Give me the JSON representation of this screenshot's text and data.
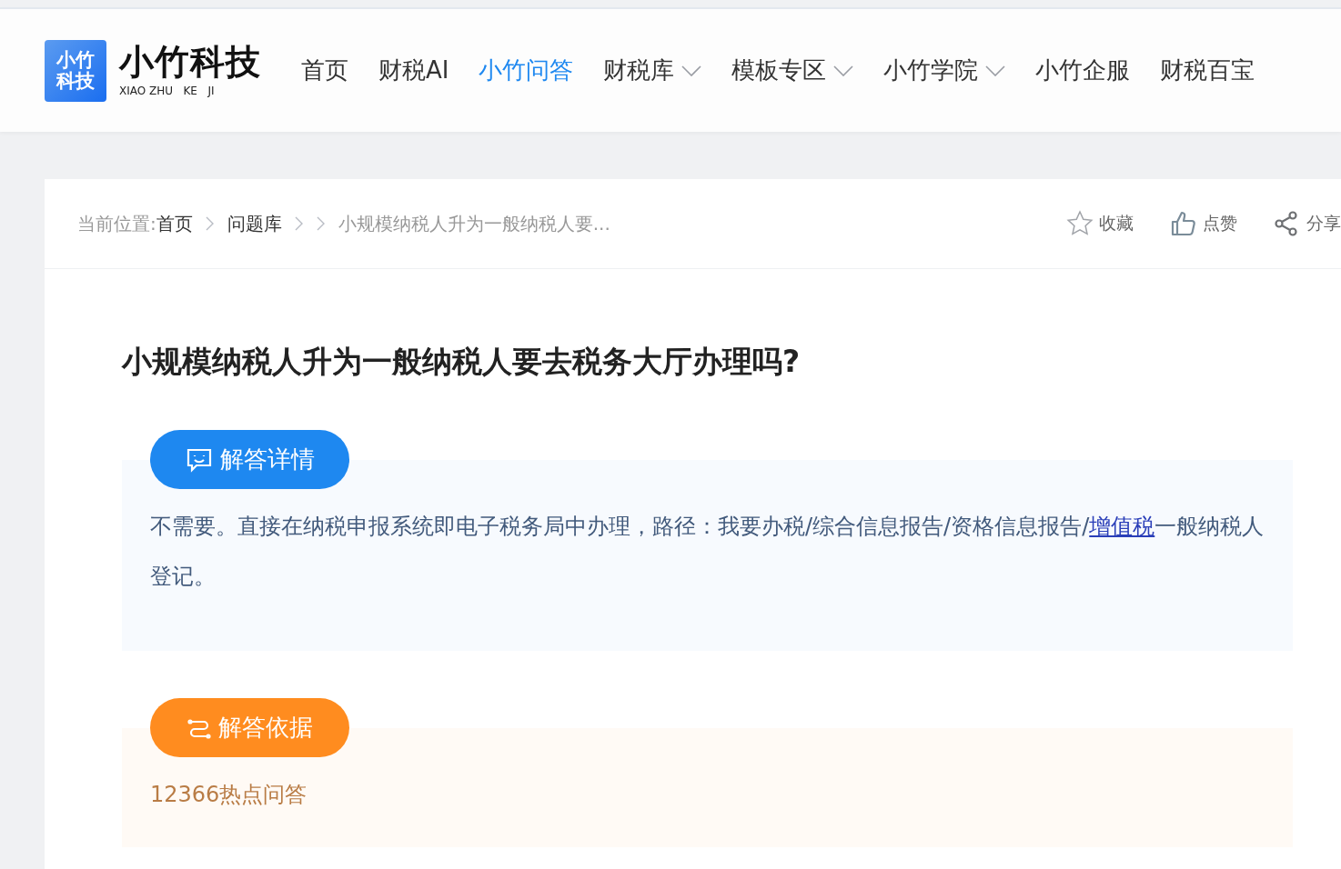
{
  "logo": {
    "mark": "小竹科技",
    "name": "小竹科技",
    "pinyin": "XIAO ZHU   KE   JI"
  },
  "nav": [
    {
      "label": "首页",
      "selected": false,
      "dropdown": false
    },
    {
      "label": "财税AI",
      "selected": false,
      "dropdown": false
    },
    {
      "label": "小竹问答",
      "selected": true,
      "dropdown": false
    },
    {
      "label": "财税库",
      "selected": false,
      "dropdown": true
    },
    {
      "label": "模板专区",
      "selected": false,
      "dropdown": true
    },
    {
      "label": "小竹学院",
      "selected": false,
      "dropdown": true
    },
    {
      "label": "小竹企服",
      "selected": false,
      "dropdown": false
    },
    {
      "label": "财税百宝",
      "selected": false,
      "dropdown": false
    }
  ],
  "breadcrumb": {
    "prefix": "当前位置:",
    "items": [
      {
        "label": "首页",
        "kind": "link"
      },
      {
        "label": "问题库",
        "kind": "link"
      },
      {
        "kind": "empty"
      },
      {
        "label": "小规模纳税人升为一般纳税人要...",
        "kind": "current"
      }
    ]
  },
  "actions": [
    {
      "label": "收藏",
      "kind": "star"
    },
    {
      "label": "点赞",
      "kind": "thumb"
    },
    {
      "label": "分享",
      "kind": "share"
    }
  ],
  "question": {
    "title": "小规模纳税人升为一般纳税人要去税务大厅办理吗?"
  },
  "sections": [
    {
      "kind": "answer",
      "button": "解答详情",
      "parts": [
        {
          "text": "不需要。直接在纳税申报系统即电子税务局中办理，路径：我要办税/综合信息报告/资格信息报告/",
          "link": false
        },
        {
          "text": "增值税",
          "link": true
        },
        {
          "text": "一般纳税人登记。",
          "link": false
        }
      ]
    },
    {
      "kind": "basis",
      "button": "解答依据",
      "parts": [
        {
          "text": "12366热点问答",
          "link": false
        }
      ]
    }
  ]
}
